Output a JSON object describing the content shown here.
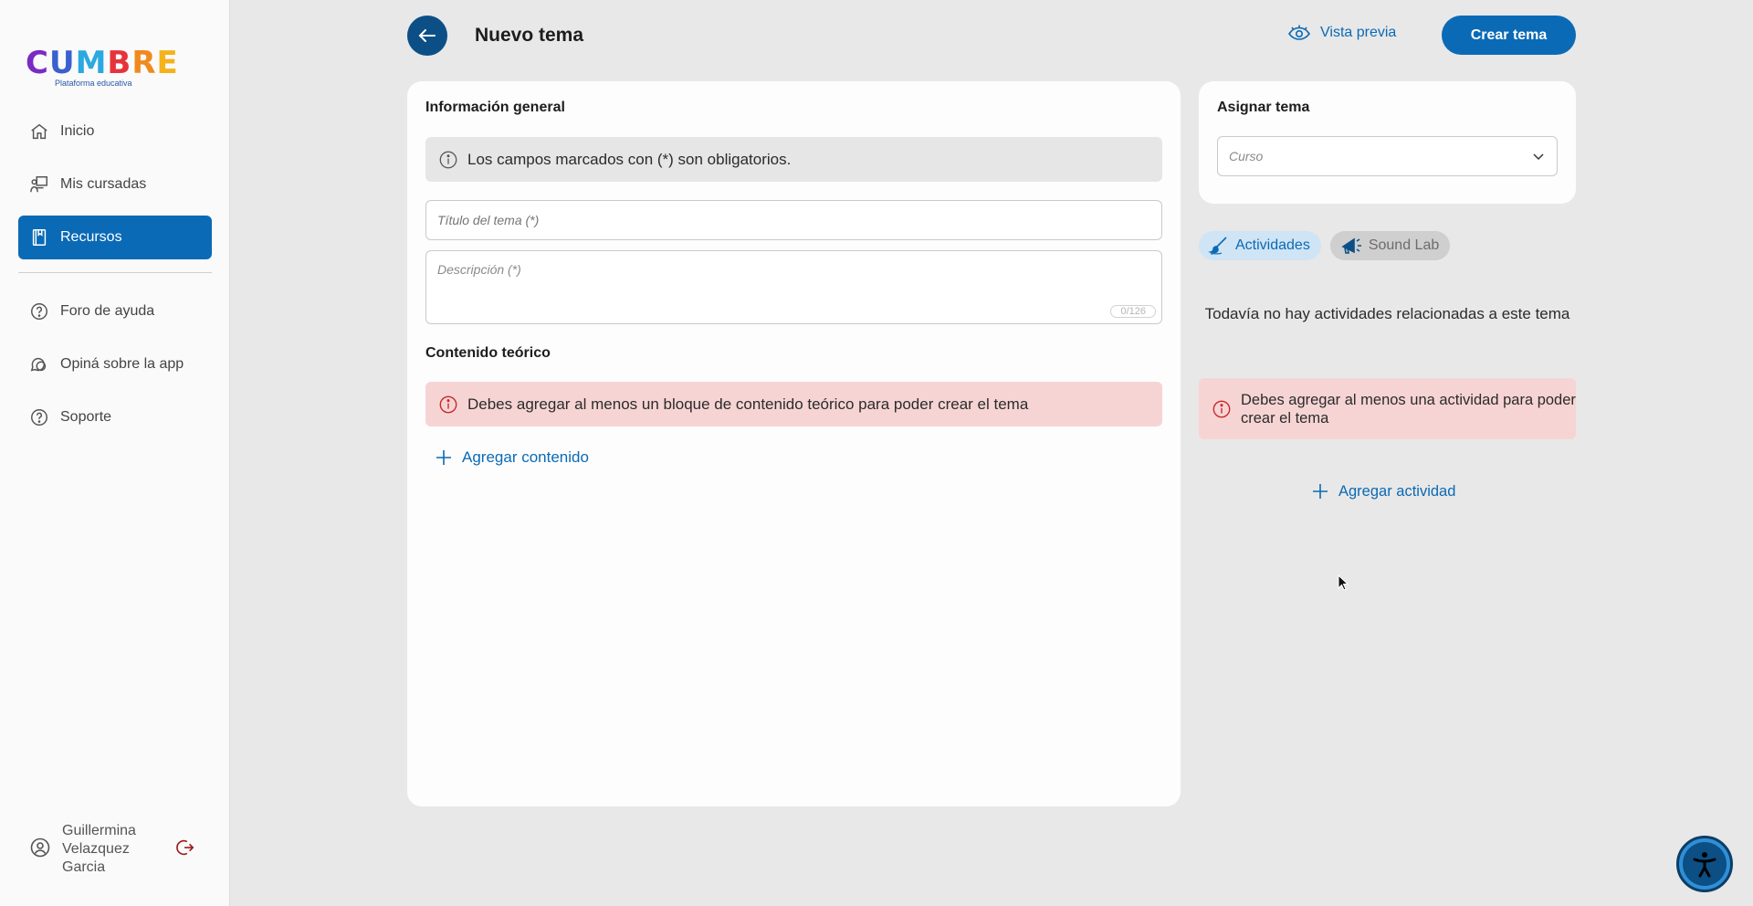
{
  "brand": {
    "letters": [
      "C",
      "U",
      "M",
      "B",
      "R",
      "E"
    ],
    "letter_colors": [
      "#7a2bc4",
      "#3a5fcf",
      "#2ba9e0",
      "#e6333b",
      "#f08a1e",
      "#f5b21b"
    ],
    "tagline": "Plataforma educativa"
  },
  "sidebar": {
    "items": [
      {
        "label": "Inicio",
        "icon": "home-icon",
        "active": false
      },
      {
        "label": "Mis cursadas",
        "icon": "teacher-board-icon",
        "active": false
      },
      {
        "label": "Recursos",
        "icon": "book-icon",
        "active": true
      }
    ],
    "secondary_items": [
      {
        "label": "Foro de ayuda",
        "icon": "help-circle-icon"
      },
      {
        "label": "Opiná sobre la app",
        "icon": "chat-bubbles-icon"
      },
      {
        "label": "Soporte",
        "icon": "help-circle-icon"
      }
    ],
    "user": {
      "name": "Guillermina Velazquez Garcia",
      "logout_icon": "logout-icon"
    }
  },
  "header": {
    "title": "Nuevo tema",
    "preview_label": "Vista previa",
    "create_label": "Crear tema"
  },
  "general": {
    "section_title": "Información general",
    "notice": "Los campos marcados con (*) son obligatorios.",
    "title_placeholder": "Título del tema (*)",
    "description_placeholder": "Descripción (*)",
    "description_counter": "0/126"
  },
  "content": {
    "section_title": "Contenido teórico",
    "error": "Debes agregar al menos un bloque de contenido teórico para poder crear el tema",
    "add_label": "Agregar contenido"
  },
  "assign": {
    "section_title": "Asignar tema",
    "course_placeholder": "Curso"
  },
  "tabs": [
    {
      "label": "Actividades",
      "icon": "paint-brush-icon",
      "active": true
    },
    {
      "label": "Sound Lab",
      "icon": "megaphone-icon",
      "active": false
    }
  ],
  "activities": {
    "empty_message": "Todavía no hay actividades relacionadas a este tema",
    "error": "Debes agregar al menos una actividad para poder crear el tema",
    "add_label": "Agregar actividad"
  },
  "colors": {
    "primary": "#0b6ab5",
    "dark_primary": "#0c4f86",
    "error_bg": "#f7d4d4",
    "error_icon": "#c62828"
  }
}
